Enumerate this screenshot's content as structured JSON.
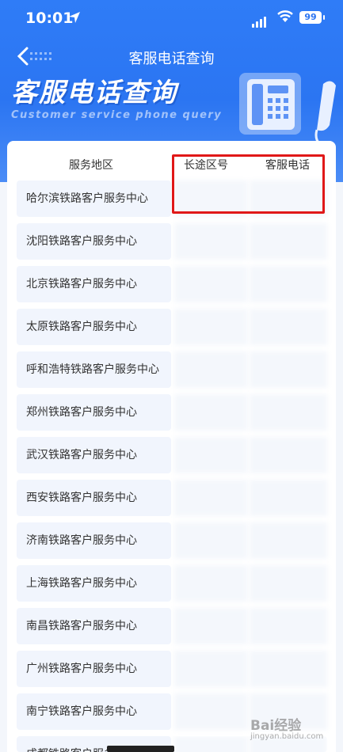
{
  "status_bar": {
    "time": "10:01",
    "battery": "99"
  },
  "nav": {
    "title": "客服电话查询"
  },
  "hero": {
    "title": "客服电话查询",
    "subtitle": "Customer service phone query"
  },
  "table": {
    "headers": {
      "area": "服务地区",
      "code": "长途区号",
      "phone": "客服电话"
    },
    "rows": [
      {
        "name": "哈尔滨铁路客户服务中心"
      },
      {
        "name": "沈阳铁路客户服务中心"
      },
      {
        "name": "北京铁路客户服务中心"
      },
      {
        "name": "太原铁路客户服务中心"
      },
      {
        "name": "呼和浩特铁路客户服务中心"
      },
      {
        "name": "郑州铁路客户服务中心"
      },
      {
        "name": "武汉铁路客户服务中心"
      },
      {
        "name": "西安铁路客户服务中心"
      },
      {
        "name": "济南铁路客户服务中心"
      },
      {
        "name": "上海铁路客户服务中心"
      },
      {
        "name": "南昌铁路客户服务中心"
      },
      {
        "name": "广州铁路客户服务中心"
      },
      {
        "name": "南宁铁路客户服务中心"
      },
      {
        "name": "成都铁路客户服务中心"
      }
    ]
  },
  "watermark": {
    "text": "Bai经验",
    "sub": "jingyan.baidu.com"
  },
  "colors": {
    "header_blue": "#2b75f2",
    "highlight_red": "#e01818"
  }
}
